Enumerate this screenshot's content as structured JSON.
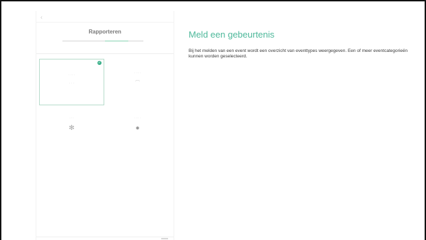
{
  "mockup": {
    "back_icon": "chevron-left-icon",
    "title": "Rapporteren",
    "accent_color": "#4db89a",
    "tiles": [
      {
        "label": "",
        "icon": "",
        "selected": true
      },
      {
        "label": "",
        "icon": "",
        "selected": false
      },
      {
        "label": "",
        "icon": "",
        "selected": false
      },
      {
        "label": "",
        "icon": "",
        "selected": false
      }
    ]
  },
  "content": {
    "heading": "Meld een gebeurtenis",
    "description": "Bij het melden van een event wordt een overzicht van eventtypes weergegeven. Een of meer eventcategorieën kunnen worden geselecteerd."
  }
}
